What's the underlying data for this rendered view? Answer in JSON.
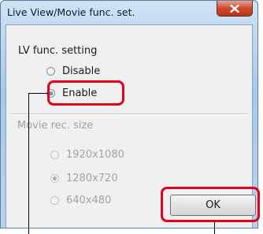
{
  "window": {
    "title": "Live View/Movie func. set.",
    "close_icon": "close-icon"
  },
  "lv_func": {
    "label": "LV func. setting",
    "options": [
      {
        "label": "Disable",
        "selected": false
      },
      {
        "label": "Enable",
        "selected": true
      }
    ]
  },
  "movie_rec": {
    "label": "Movie rec. size",
    "enabled": false,
    "options": [
      {
        "label": "1920x1080",
        "selected": false
      },
      {
        "label": "1280x720",
        "selected": true
      },
      {
        "label": "640x480",
        "selected": false
      }
    ]
  },
  "buttons": {
    "ok_label": "OK"
  },
  "colors": {
    "highlight": "#e4001b"
  }
}
